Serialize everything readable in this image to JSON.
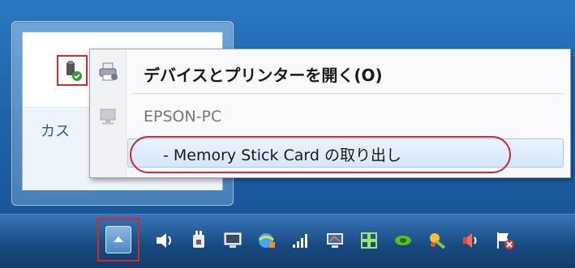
{
  "flyout": {
    "link_text": "カス",
    "icons": [
      "usb-safely-remove-icon"
    ]
  },
  "context_menu": {
    "items": [
      {
        "label": "デバイスとプリンターを開く(O)",
        "icon": "printer-icon",
        "bold": true
      },
      {
        "label": "EPSON-PC",
        "icon": "computer-icon",
        "disabled": true
      },
      {
        "label": "-  Memory Stick Card の取り出し",
        "icon": "",
        "highlighted": true
      }
    ]
  },
  "taskbar": {
    "tray_button": "show-hidden-icons-button",
    "tray_icons": [
      "speaker-wave-icon",
      "power-plug-icon",
      "computer-monitor-icon",
      "network-globe-icon",
      "signal-bars-icon",
      "network-display-icon",
      "grid-app-icon",
      "nvidia-icon",
      "color-icon",
      "volume-icon",
      "action-center-flag-icon"
    ]
  },
  "colors": {
    "highlight": "#d12a2a",
    "link": "#1f5ca8"
  }
}
